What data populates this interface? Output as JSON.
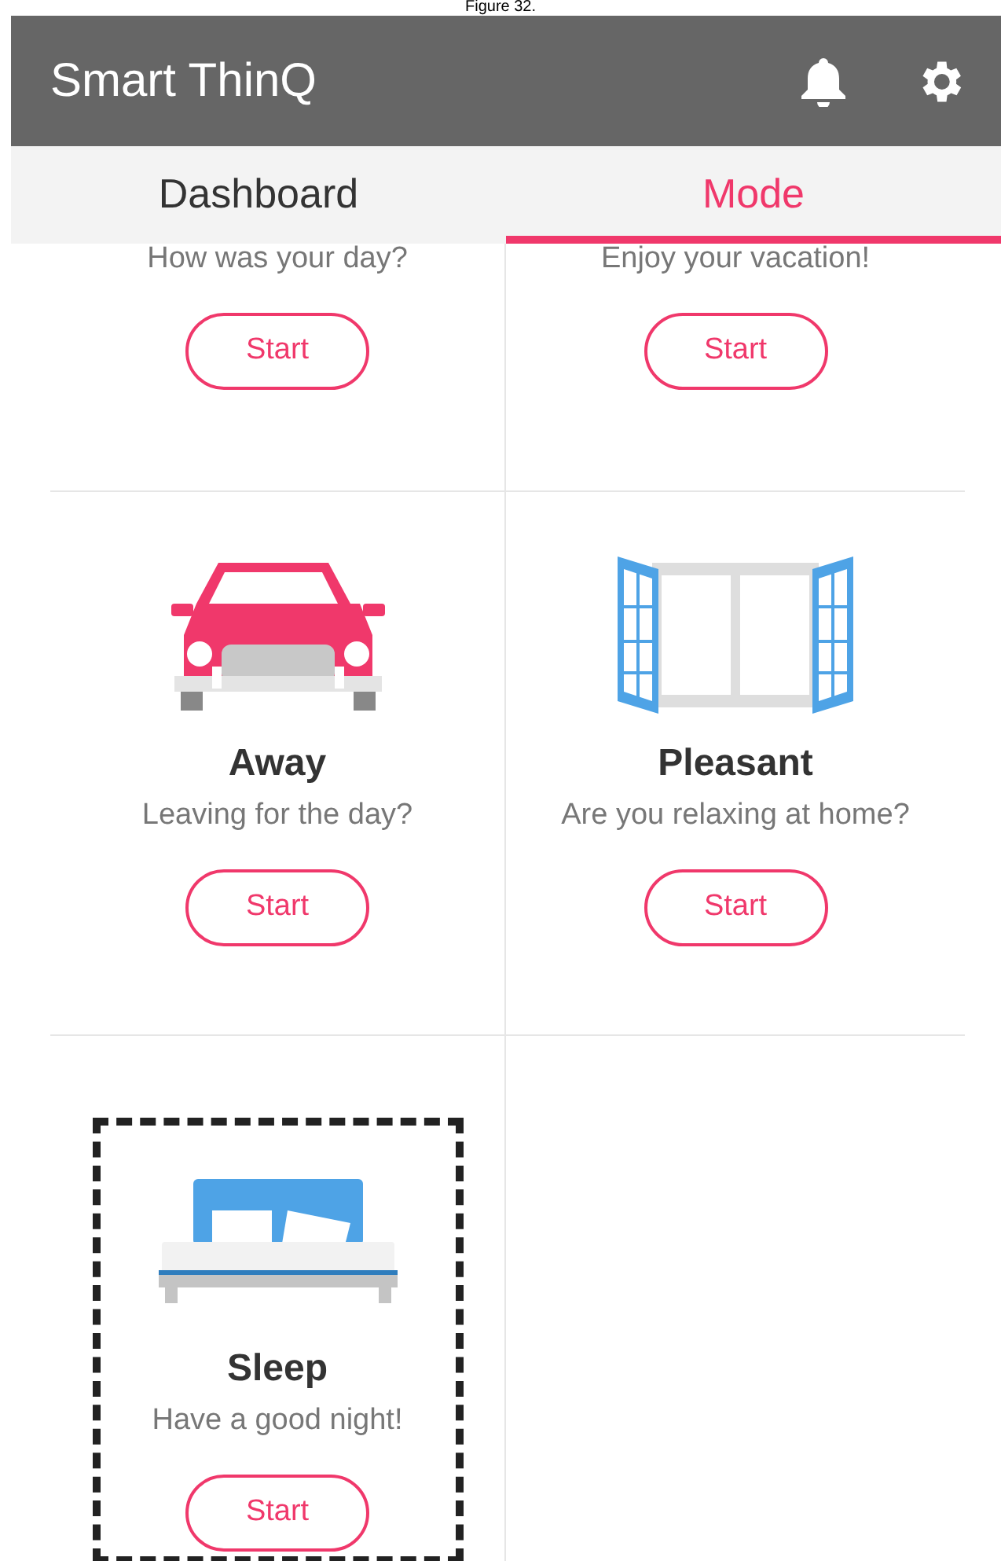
{
  "caption": "Figure 32.",
  "app_bar": {
    "title": "Smart ThinQ"
  },
  "tabs": [
    {
      "label": "Dashboard",
      "selected": false
    },
    {
      "label": "Mode",
      "selected": true
    }
  ],
  "modes": [
    {
      "kind": "partial",
      "subtitle": "How was your day?",
      "button": "Start",
      "highlighted": false
    },
    {
      "kind": "partial",
      "subtitle": "Enjoy your vacation!",
      "button": "Start",
      "highlighted": false
    },
    {
      "kind": "car",
      "title": "Away",
      "subtitle": "Leaving for the day?",
      "button": "Start",
      "highlighted": false
    },
    {
      "kind": "window",
      "title": "Pleasant",
      "subtitle": "Are you relaxing at home?",
      "button": "Start",
      "highlighted": false
    },
    {
      "kind": "bed",
      "title": "Sleep",
      "subtitle": "Have a good night!",
      "button": "Start",
      "highlighted": true
    }
  ]
}
